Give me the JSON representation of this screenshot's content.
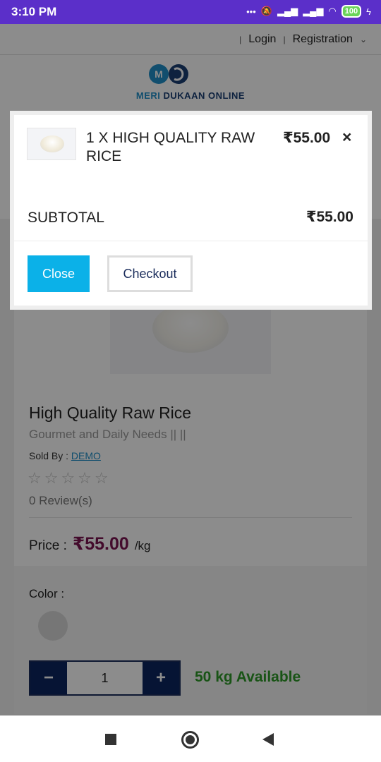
{
  "status_bar": {
    "time": "3:10 PM",
    "battery": "100"
  },
  "header": {
    "login": "Login",
    "registration": "Registration",
    "logo_initials_left": "M",
    "logo_text_accent": "MERI",
    "logo_text_main": " DUKAAN ONLINE"
  },
  "product": {
    "title": "High Quality Raw Rice",
    "category": "Gourmet and Daily Needs || ||",
    "sold_by_label": "Sold By :",
    "seller": "DEMO",
    "stars": "☆☆☆☆☆",
    "reviews": "0 Review(s)",
    "price_label": "Price :",
    "price": "₹55.00",
    "unit": "/kg",
    "color_label": "Color :",
    "quantity": "1",
    "availability": "50 kg Available"
  },
  "cart_modal": {
    "item_name": "1 X HIGH QUALITY RAW RICE",
    "item_price": "₹55.00",
    "remove_icon": "×",
    "subtotal_label": "SUBTOTAL",
    "subtotal": "₹55.00",
    "close_label": "Close",
    "checkout_label": "Checkout"
  },
  "colors": {
    "status_bar": "#5b2fc9",
    "close_button": "#0bb1e8",
    "price": "#7b1450",
    "available": "#2e9a28",
    "stepper": "#0c2560"
  }
}
